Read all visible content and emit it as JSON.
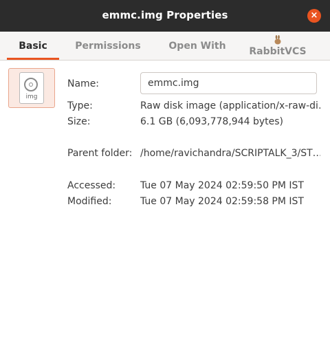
{
  "window": {
    "title": "emmc.img Properties",
    "close_glyph": "×"
  },
  "tabs": [
    {
      "label": "Basic",
      "active": true
    },
    {
      "label": "Permissions",
      "active": false
    },
    {
      "label": "Open With",
      "active": false
    },
    {
      "label": "RabbitVCS",
      "active": false,
      "icon": "rabbit-icon"
    }
  ],
  "file_icon": {
    "name": "disk-image-icon",
    "tag": "img"
  },
  "fields": {
    "name_label": "Name:",
    "name_value": "emmc.img",
    "type_label": "Type:",
    "type_value": "Raw disk image (application/x-raw-di…",
    "size_label": "Size:",
    "size_value": "6.1 GB (6,093,778,944 bytes)",
    "parent_label": "Parent folder:",
    "parent_value": "/home/ravichandra/SCRIPTALK_3/ST…",
    "accessed_label": "Accessed:",
    "accessed_value": "Tue 07 May 2024 02:59:50 PM IST",
    "modified_label": "Modified:",
    "modified_value": "Tue 07 May 2024 02:59:58 PM IST"
  },
  "colors": {
    "accent": "#e95420",
    "titlebar": "#2c2c2c"
  }
}
